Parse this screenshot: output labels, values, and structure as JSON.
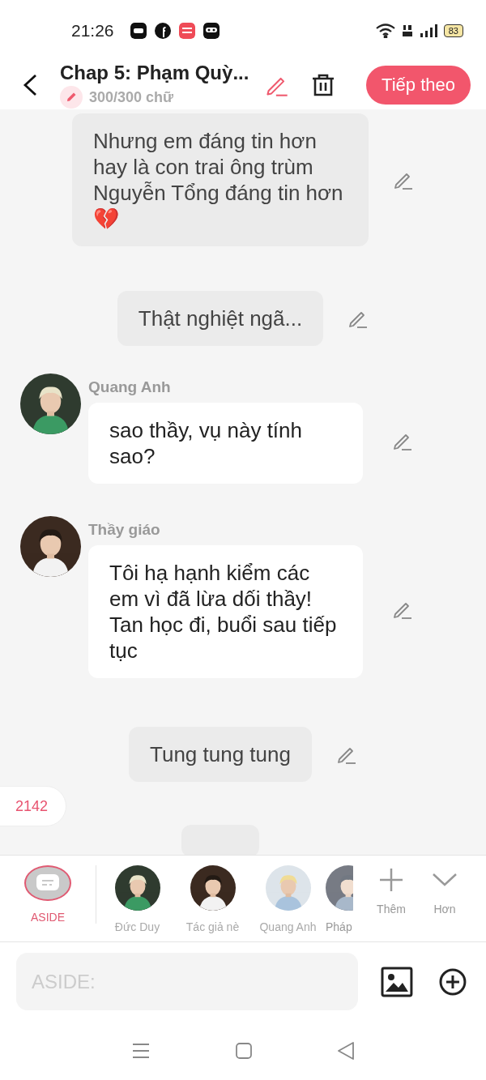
{
  "status_bar": {
    "time": "21:26",
    "battery": "83"
  },
  "header": {
    "title": "Chap 5: Phạm Quỳ...",
    "word_count": "300/300 chữ",
    "next_button": "Tiếp theo"
  },
  "messages": [
    {
      "kind": "aside",
      "text": "Nhưng em đáng tin hơn hay là con trai ông trùm Nguyễn Tổng đáng tin hơn 💔"
    },
    {
      "kind": "aside",
      "text": "Thật nghiệt ngã..."
    },
    {
      "kind": "character",
      "name": "Quang Anh",
      "text": "sao thầy, vụ này tính sao?"
    },
    {
      "kind": "character",
      "name": "Thầy giáo",
      "text": "Tôi hạ hạnh kiểm các em vì đã lừa dối thầy! Tan học đi, buổi sau tiếp tục"
    },
    {
      "kind": "aside",
      "text": "Tung tung tung"
    }
  ],
  "counter_badge": "2142",
  "characters": [
    {
      "kind": "aside",
      "name": "ASIDE",
      "selected": true
    },
    {
      "kind": "avatar",
      "name": "Đức Duy",
      "selected": false
    },
    {
      "kind": "avatar",
      "name": "Tác giả nè",
      "selected": false
    },
    {
      "kind": "avatar",
      "name": "Quang Anh",
      "selected": false
    },
    {
      "kind": "avatar",
      "name": "Pháp",
      "selected": false
    }
  ],
  "actions": [
    {
      "kind": "add",
      "label": "Thêm"
    },
    {
      "kind": "more",
      "label": "Hơn"
    }
  ],
  "input": {
    "placeholder": "ASIDE:"
  }
}
